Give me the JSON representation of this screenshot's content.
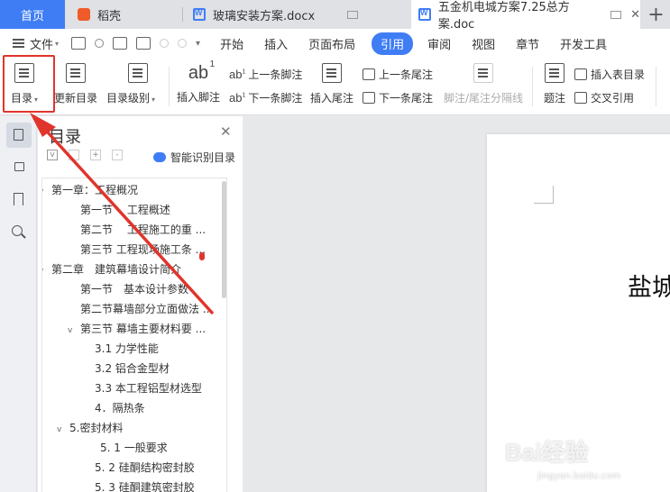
{
  "tabs": [
    {
      "label": "首页"
    },
    {
      "label": "稻壳"
    },
    {
      "label": "玻璃安装方案.docx"
    },
    {
      "label": "五金机电城方案7.25总方案.doc"
    }
  ],
  "tab_plus": "+",
  "menu": {
    "file": "文件",
    "items": [
      "开始",
      "插入",
      "页面布局",
      "引用",
      "审阅",
      "视图",
      "章节",
      "开发工具"
    ],
    "active": "引用"
  },
  "ribbon": {
    "toc": "目录",
    "update_toc": "更新目录",
    "toc_level": "目录级别",
    "insert_footnote": "插入脚注",
    "prev_footnote": "上一条脚注",
    "next_footnote": "下一条脚注",
    "insert_endnote": "插入尾注",
    "prev_endnote": "上一条尾注",
    "next_endnote": "下一条尾注",
    "separator": "脚注/尾注分隔线",
    "caption": "题注",
    "insert_table_toc": "插入表目录",
    "cross_ref": "交叉引用"
  },
  "toc_panel": {
    "title": "目录",
    "smart": "智能识别目录",
    "items": [
      {
        "text": "第一章：工程概况",
        "level": 0,
        "toggle": "v"
      },
      {
        "text": "第一节　 工程概述",
        "level": 1,
        "toggle": ""
      },
      {
        "text": "第二节　 工程施工的重 ...",
        "level": 1,
        "toggle": ""
      },
      {
        "text": "第三节  工程现场施工条 ...",
        "level": 1,
        "toggle": ""
      },
      {
        "text": "第二章　建筑幕墙设计简介",
        "level": 0,
        "toggle": "v"
      },
      {
        "text": "第一节　基本设计参数",
        "level": 1,
        "toggle": ""
      },
      {
        "text": "第二节幕墙部分立面做法 ...",
        "level": 1,
        "toggle": ""
      },
      {
        "text": "第三节  幕墙主要材料要 ...",
        "level": 1,
        "toggle": "v"
      },
      {
        "text": "3.1 力学性能",
        "level": 2,
        "toggle": ""
      },
      {
        "text": "3.2 铝合金型材",
        "level": 2,
        "toggle": ""
      },
      {
        "text": "3.3 本工程铝型材选型",
        "level": 2,
        "toggle": ""
      },
      {
        "text": "4．隔热条",
        "level": 2,
        "toggle": ""
      },
      {
        "text": "5.密封材料",
        "level": 1.5,
        "toggle": "v"
      },
      {
        "text": "5. 1 一般要求",
        "level": 2.4,
        "toggle": ""
      },
      {
        "text": "5. 2 硅酮结构密封胶",
        "level": 2,
        "toggle": ""
      },
      {
        "text": "5. 3 硅酮建筑密封胶",
        "level": 2,
        "toggle": ""
      }
    ]
  },
  "document": {
    "title": "盐城"
  },
  "watermark": {
    "main": "Bai经验",
    "sub": "jingyan.baidu.com"
  },
  "colors": {
    "accent": "#3f7df5",
    "highlight": "#e0342c"
  }
}
